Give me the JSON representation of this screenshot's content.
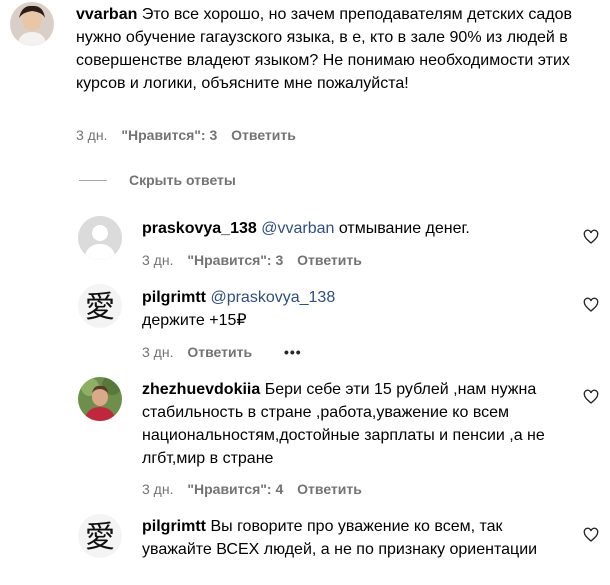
{
  "comments": [
    {
      "username": "vvarban",
      "text": "Это все хорошо, но зачем преподавателям детских садов нужно обучение гагаузского языка, в е, кто в зале 90% из людей в совершенстве владеют языком? Не понимаю необходимости этих курсов и логики, объясните мне пожалуйста!",
      "time": "3 дн.",
      "likes": "\"Нравится\": 3",
      "reply": "Ответить"
    },
    {
      "username": "praskovya_138",
      "mention": "@vvarban",
      "text": "отмывание денег.",
      "time": "3 дн.",
      "likes": "\"Нравится\": 3",
      "reply": "Ответить"
    },
    {
      "username": "pilgrimtt",
      "mention": "@praskovya_138",
      "text": "держите +15₽",
      "time": "3 дн.",
      "reply": "Ответить",
      "more": "•••"
    },
    {
      "username": "zhezhuevdokiia",
      "text": "Бери себе эти 15 рублей ,нам нужна стабильность в стране ,работа,уважение ко всем национальностям,достойные зарплаты и пенсии ,а не лгбт,мир в стране",
      "time": "3 дн.",
      "likes": "\"Нравится\": 4",
      "reply": "Ответить"
    },
    {
      "username": "pilgrimtt",
      "text": "Вы говорите про уважение ко всем, так уважайте ВСЕХ людей, а не по признаку ориентации"
    }
  ],
  "hide_replies_label": "Скрыть ответы",
  "icons": {
    "like": "heart-icon",
    "avatar_kanji": "愛"
  },
  "colors": {
    "mention": "#2e4f82",
    "meta": "#737373"
  }
}
